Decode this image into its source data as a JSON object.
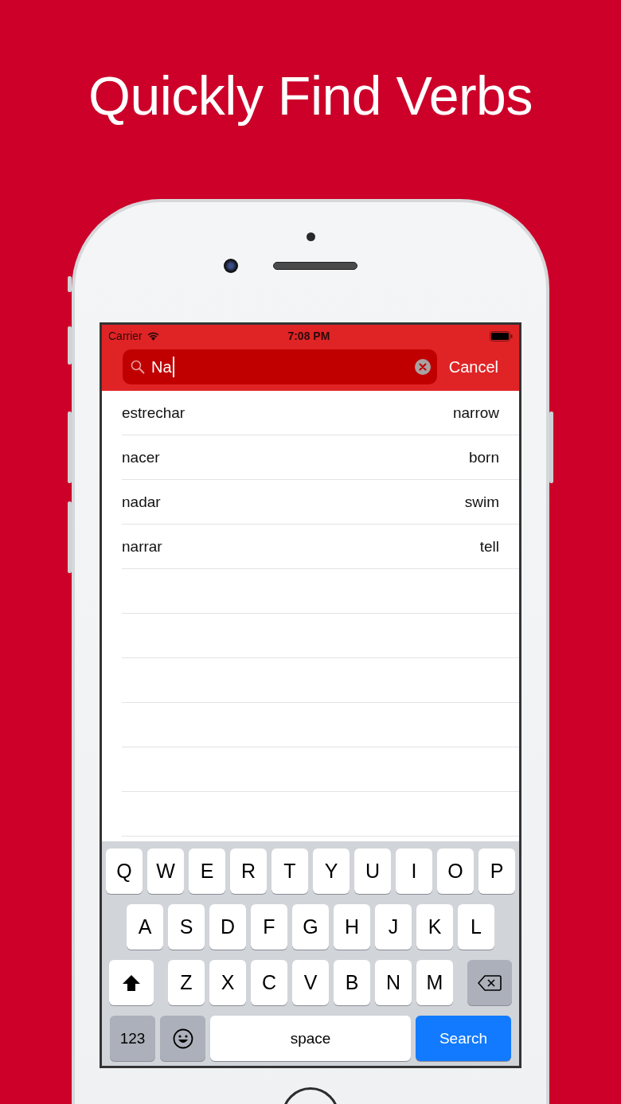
{
  "headline": "Quickly Find Verbs",
  "status_bar": {
    "carrier": "Carrier",
    "time": "7:08 PM"
  },
  "search": {
    "value": "Na",
    "cancel": "Cancel"
  },
  "results": [
    {
      "spanish": "estrechar",
      "english": "narrow"
    },
    {
      "spanish": "nacer",
      "english": "born"
    },
    {
      "spanish": "nadar",
      "english": "swim"
    },
    {
      "spanish": "narrar",
      "english": "tell"
    }
  ],
  "keyboard": {
    "rows": [
      [
        "Q",
        "W",
        "E",
        "R",
        "T",
        "Y",
        "U",
        "I",
        "O",
        "P"
      ],
      [
        "A",
        "S",
        "D",
        "F",
        "G",
        "H",
        "J",
        "K",
        "L"
      ],
      [
        "Z",
        "X",
        "C",
        "V",
        "B",
        "N",
        "M"
      ]
    ],
    "numbers_key": "123",
    "space_key": "space",
    "return_key": "Search"
  }
}
